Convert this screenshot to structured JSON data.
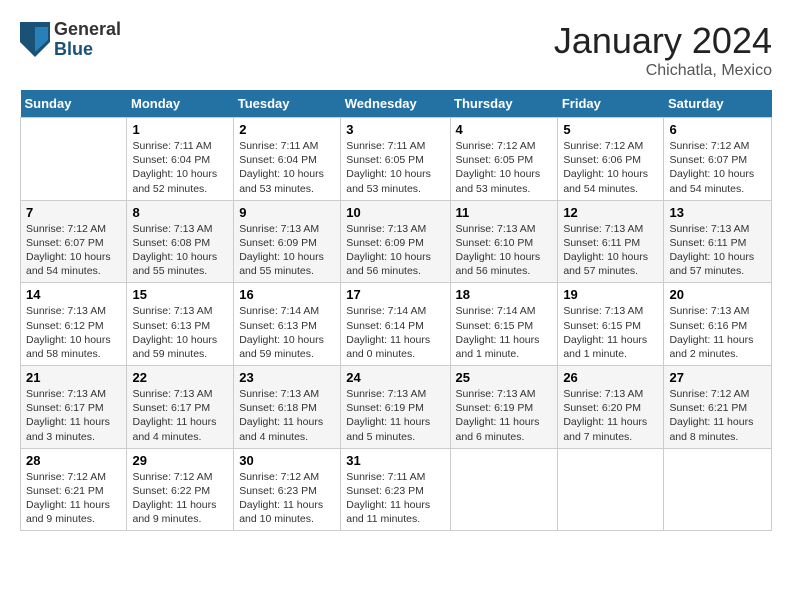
{
  "header": {
    "logo_general": "General",
    "logo_blue": "Blue",
    "title": "January 2024",
    "location": "Chichatla, Mexico"
  },
  "weekdays": [
    "Sunday",
    "Monday",
    "Tuesday",
    "Wednesday",
    "Thursday",
    "Friday",
    "Saturday"
  ],
  "weeks": [
    [
      {
        "day": "",
        "info": ""
      },
      {
        "day": "1",
        "info": "Sunrise: 7:11 AM\nSunset: 6:04 PM\nDaylight: 10 hours\nand 52 minutes."
      },
      {
        "day": "2",
        "info": "Sunrise: 7:11 AM\nSunset: 6:04 PM\nDaylight: 10 hours\nand 53 minutes."
      },
      {
        "day": "3",
        "info": "Sunrise: 7:11 AM\nSunset: 6:05 PM\nDaylight: 10 hours\nand 53 minutes."
      },
      {
        "day": "4",
        "info": "Sunrise: 7:12 AM\nSunset: 6:05 PM\nDaylight: 10 hours\nand 53 minutes."
      },
      {
        "day": "5",
        "info": "Sunrise: 7:12 AM\nSunset: 6:06 PM\nDaylight: 10 hours\nand 54 minutes."
      },
      {
        "day": "6",
        "info": "Sunrise: 7:12 AM\nSunset: 6:07 PM\nDaylight: 10 hours\nand 54 minutes."
      }
    ],
    [
      {
        "day": "7",
        "info": "Sunrise: 7:12 AM\nSunset: 6:07 PM\nDaylight: 10 hours\nand 54 minutes."
      },
      {
        "day": "8",
        "info": "Sunrise: 7:13 AM\nSunset: 6:08 PM\nDaylight: 10 hours\nand 55 minutes."
      },
      {
        "day": "9",
        "info": "Sunrise: 7:13 AM\nSunset: 6:09 PM\nDaylight: 10 hours\nand 55 minutes."
      },
      {
        "day": "10",
        "info": "Sunrise: 7:13 AM\nSunset: 6:09 PM\nDaylight: 10 hours\nand 56 minutes."
      },
      {
        "day": "11",
        "info": "Sunrise: 7:13 AM\nSunset: 6:10 PM\nDaylight: 10 hours\nand 56 minutes."
      },
      {
        "day": "12",
        "info": "Sunrise: 7:13 AM\nSunset: 6:11 PM\nDaylight: 10 hours\nand 57 minutes."
      },
      {
        "day": "13",
        "info": "Sunrise: 7:13 AM\nSunset: 6:11 PM\nDaylight: 10 hours\nand 57 minutes."
      }
    ],
    [
      {
        "day": "14",
        "info": "Sunrise: 7:13 AM\nSunset: 6:12 PM\nDaylight: 10 hours\nand 58 minutes."
      },
      {
        "day": "15",
        "info": "Sunrise: 7:13 AM\nSunset: 6:13 PM\nDaylight: 10 hours\nand 59 minutes."
      },
      {
        "day": "16",
        "info": "Sunrise: 7:14 AM\nSunset: 6:13 PM\nDaylight: 10 hours\nand 59 minutes."
      },
      {
        "day": "17",
        "info": "Sunrise: 7:14 AM\nSunset: 6:14 PM\nDaylight: 11 hours\nand 0 minutes."
      },
      {
        "day": "18",
        "info": "Sunrise: 7:14 AM\nSunset: 6:15 PM\nDaylight: 11 hours\nand 1 minute."
      },
      {
        "day": "19",
        "info": "Sunrise: 7:13 AM\nSunset: 6:15 PM\nDaylight: 11 hours\nand 1 minute."
      },
      {
        "day": "20",
        "info": "Sunrise: 7:13 AM\nSunset: 6:16 PM\nDaylight: 11 hours\nand 2 minutes."
      }
    ],
    [
      {
        "day": "21",
        "info": "Sunrise: 7:13 AM\nSunset: 6:17 PM\nDaylight: 11 hours\nand 3 minutes."
      },
      {
        "day": "22",
        "info": "Sunrise: 7:13 AM\nSunset: 6:17 PM\nDaylight: 11 hours\nand 4 minutes."
      },
      {
        "day": "23",
        "info": "Sunrise: 7:13 AM\nSunset: 6:18 PM\nDaylight: 11 hours\nand 4 minutes."
      },
      {
        "day": "24",
        "info": "Sunrise: 7:13 AM\nSunset: 6:19 PM\nDaylight: 11 hours\nand 5 minutes."
      },
      {
        "day": "25",
        "info": "Sunrise: 7:13 AM\nSunset: 6:19 PM\nDaylight: 11 hours\nand 6 minutes."
      },
      {
        "day": "26",
        "info": "Sunrise: 7:13 AM\nSunset: 6:20 PM\nDaylight: 11 hours\nand 7 minutes."
      },
      {
        "day": "27",
        "info": "Sunrise: 7:12 AM\nSunset: 6:21 PM\nDaylight: 11 hours\nand 8 minutes."
      }
    ],
    [
      {
        "day": "28",
        "info": "Sunrise: 7:12 AM\nSunset: 6:21 PM\nDaylight: 11 hours\nand 9 minutes."
      },
      {
        "day": "29",
        "info": "Sunrise: 7:12 AM\nSunset: 6:22 PM\nDaylight: 11 hours\nand 9 minutes."
      },
      {
        "day": "30",
        "info": "Sunrise: 7:12 AM\nSunset: 6:23 PM\nDaylight: 11 hours\nand 10 minutes."
      },
      {
        "day": "31",
        "info": "Sunrise: 7:11 AM\nSunset: 6:23 PM\nDaylight: 11 hours\nand 11 minutes."
      },
      {
        "day": "",
        "info": ""
      },
      {
        "day": "",
        "info": ""
      },
      {
        "day": "",
        "info": ""
      }
    ]
  ]
}
